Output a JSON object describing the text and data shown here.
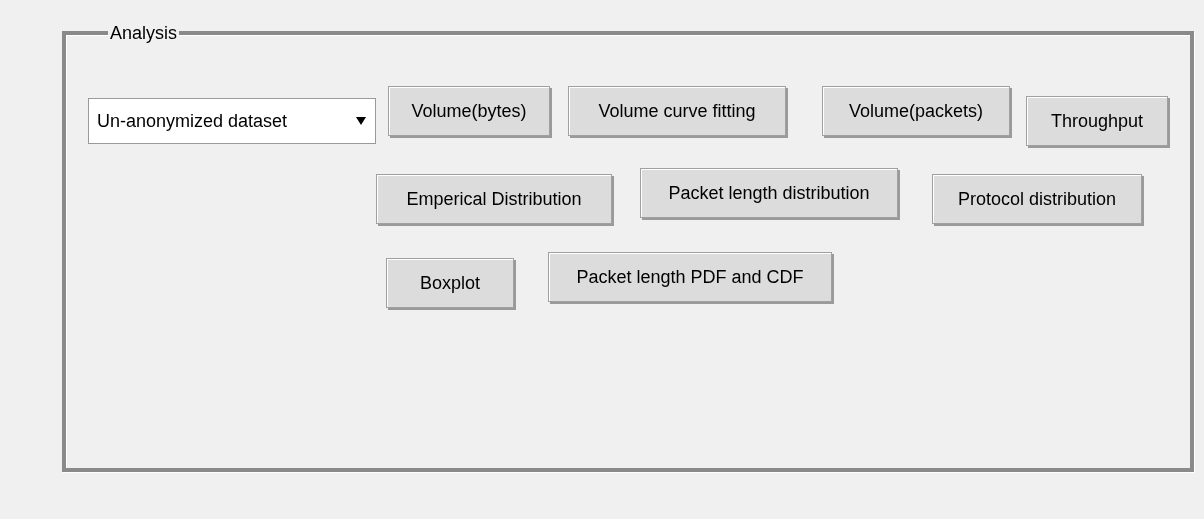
{
  "group": {
    "title": "Analysis"
  },
  "dataset_select": {
    "value": "Un-anonymized dataset"
  },
  "button_rows": [
    [
      "Volume(bytes)",
      "Volume curve fitting",
      "Volume(packets)",
      "Throughput"
    ],
    [
      "Emperical Distribution",
      "Packet length distribution",
      "Protocol distribution"
    ],
    [
      "Boxplot",
      "Packet length PDF and CDF"
    ]
  ]
}
